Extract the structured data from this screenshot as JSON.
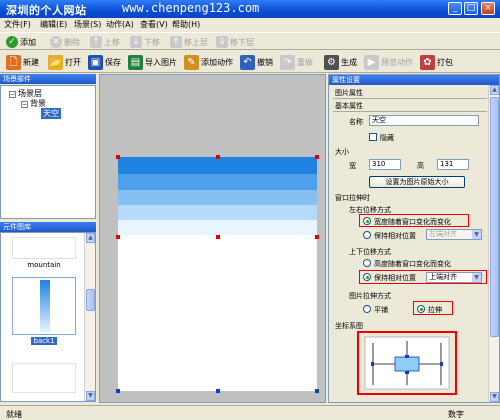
{
  "window": {
    "title": "深圳的个人网站",
    "watermark": "www.chenpeng123.com",
    "controls": [
      "_",
      "□",
      "×"
    ]
  },
  "menu": [
    "文件(F)",
    "编辑(E)",
    "场景(S)",
    "动作(A)",
    "查看(V)",
    "帮助(H)"
  ],
  "toolbar1": [
    {
      "label": "添加",
      "icon": "add-icon",
      "enabled": true
    },
    {
      "label": "删除",
      "icon": "delete-icon",
      "enabled": false
    },
    {
      "label": "上移",
      "icon": "up-icon",
      "enabled": false
    },
    {
      "label": "下移",
      "icon": "down-icon",
      "enabled": false
    },
    {
      "label": "移上层",
      "icon": "layer-up-icon",
      "enabled": false
    },
    {
      "label": "移下层",
      "icon": "layer-down-icon",
      "enabled": false
    }
  ],
  "toolbar2": [
    {
      "label": "新建",
      "icon": "new-icon",
      "enabled": true
    },
    {
      "label": "打开",
      "icon": "open-icon",
      "enabled": true
    },
    {
      "label": "保存",
      "icon": "save-icon",
      "enabled": true
    },
    {
      "label": "导入图片",
      "icon": "import-image-icon",
      "enabled": true
    },
    {
      "label": "添加动作",
      "icon": "add-action-icon",
      "enabled": true
    },
    {
      "label": "撤销",
      "icon": "undo-icon",
      "enabled": true
    },
    {
      "label": "重做",
      "icon": "redo-icon",
      "enabled": false
    },
    {
      "label": "生成",
      "icon": "generate-icon",
      "enabled": true
    },
    {
      "label": "预览动作",
      "icon": "preview-icon",
      "enabled": false
    },
    {
      "label": "打包",
      "icon": "package-icon",
      "enabled": true
    }
  ],
  "scene_panel": {
    "header": "场景部件",
    "tree": {
      "root": "场景层",
      "child": "背景",
      "selected": "天空"
    }
  },
  "element_panel": {
    "header": "元件图库",
    "items": [
      {
        "label": "mountain"
      },
      {
        "label": "back1",
        "selected": true
      }
    ]
  },
  "properties": {
    "header": "属性设置",
    "section_picture": "图片属性",
    "section_basic": "基本属性",
    "name_label": "名称",
    "name_value": "天空",
    "hidden_label": "隐藏",
    "hidden_checked": false,
    "size_section": "大小",
    "width_label": "宽",
    "width_value": "310",
    "height_label": "高",
    "height_value": "131",
    "original_size_button": "设置为图片原始大小",
    "stretch_section": "窗口拉伸时",
    "horizontal_section": "左右位移方式",
    "horizontal_options": [
      "宽度随着窗口变化而变化",
      "保持相对位置"
    ],
    "horizontal_selected": 0,
    "horizontal_align_value": "左端对齐",
    "vertical_section": "上下位移方式",
    "vertical_options": [
      "高度随着窗口变化而变化",
      "保持相对位置"
    ],
    "vertical_selected": 1,
    "vertical_align_value": "上端对齐",
    "image_stretch_section": "图片拉伸方式",
    "image_stretch_options": [
      "平铺",
      "拉伸"
    ],
    "image_stretch_selected": 1,
    "coord_section": "坐标系图"
  },
  "status": {
    "left": "就绪",
    "right": "数字"
  },
  "colors": {
    "accent": "#316ac5",
    "highlight": "#e00000",
    "sky_top": "#1f82e0",
    "sky_bottom": "#e8f4ff"
  }
}
